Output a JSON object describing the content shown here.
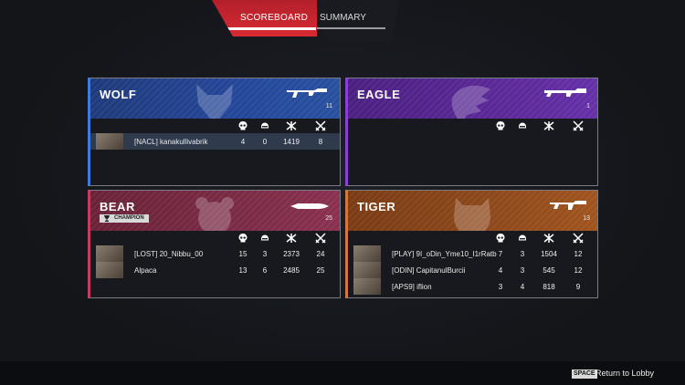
{
  "tabs": {
    "scoreboard": "SCOREBOARD",
    "summary": "SUMMARY"
  },
  "teams": {
    "wolf": {
      "name": "WOLF",
      "weapon_count": "11",
      "players": [
        {
          "name": "[NACL] kanakullivabrik",
          "kills": "4",
          "deaths": "0",
          "damage": "1419",
          "assists": "8"
        }
      ]
    },
    "eagle": {
      "name": "EAGLE",
      "weapon_count": "1",
      "players": []
    },
    "bear": {
      "name": "BEAR",
      "weapon_count": "25",
      "badge": "CHAMPION",
      "players": [
        {
          "name": "[LOST] 20_Nibbu_00",
          "kills": "15",
          "deaths": "3",
          "damage": "2373",
          "assists": "24"
        },
        {
          "name": "Alpaca",
          "kills": "13",
          "deaths": "6",
          "damage": "2485",
          "assists": "25"
        }
      ]
    },
    "tiger": {
      "name": "TIGER",
      "weapon_count": "13",
      "players": [
        {
          "name": "[PLAY] 9I_oDin_Yme10_I1rRatb",
          "kills": "7",
          "deaths": "3",
          "damage": "1504",
          "assists": "12"
        },
        {
          "name": "[ODIN] CapitanulBurcii",
          "kills": "4",
          "deaths": "3",
          "damage": "545",
          "assists": "12"
        },
        {
          "name": "[APS9] iflion",
          "kills": "3",
          "deaths": "4",
          "damage": "818",
          "assists": "9"
        }
      ]
    }
  },
  "footer": {
    "key": "SPACE",
    "action": "Return to Lobby"
  },
  "colors": {
    "wolf": "#3f7adf",
    "eagle": "#8a3fd6",
    "bear": "#c53c63",
    "tiger": "#d5773a",
    "active_tab": "#d72a33"
  },
  "icons": {
    "stats": [
      "skull-icon",
      "helmet-icon",
      "damage-icon",
      "swords-icon"
    ],
    "weapon": "rifle-icon"
  }
}
